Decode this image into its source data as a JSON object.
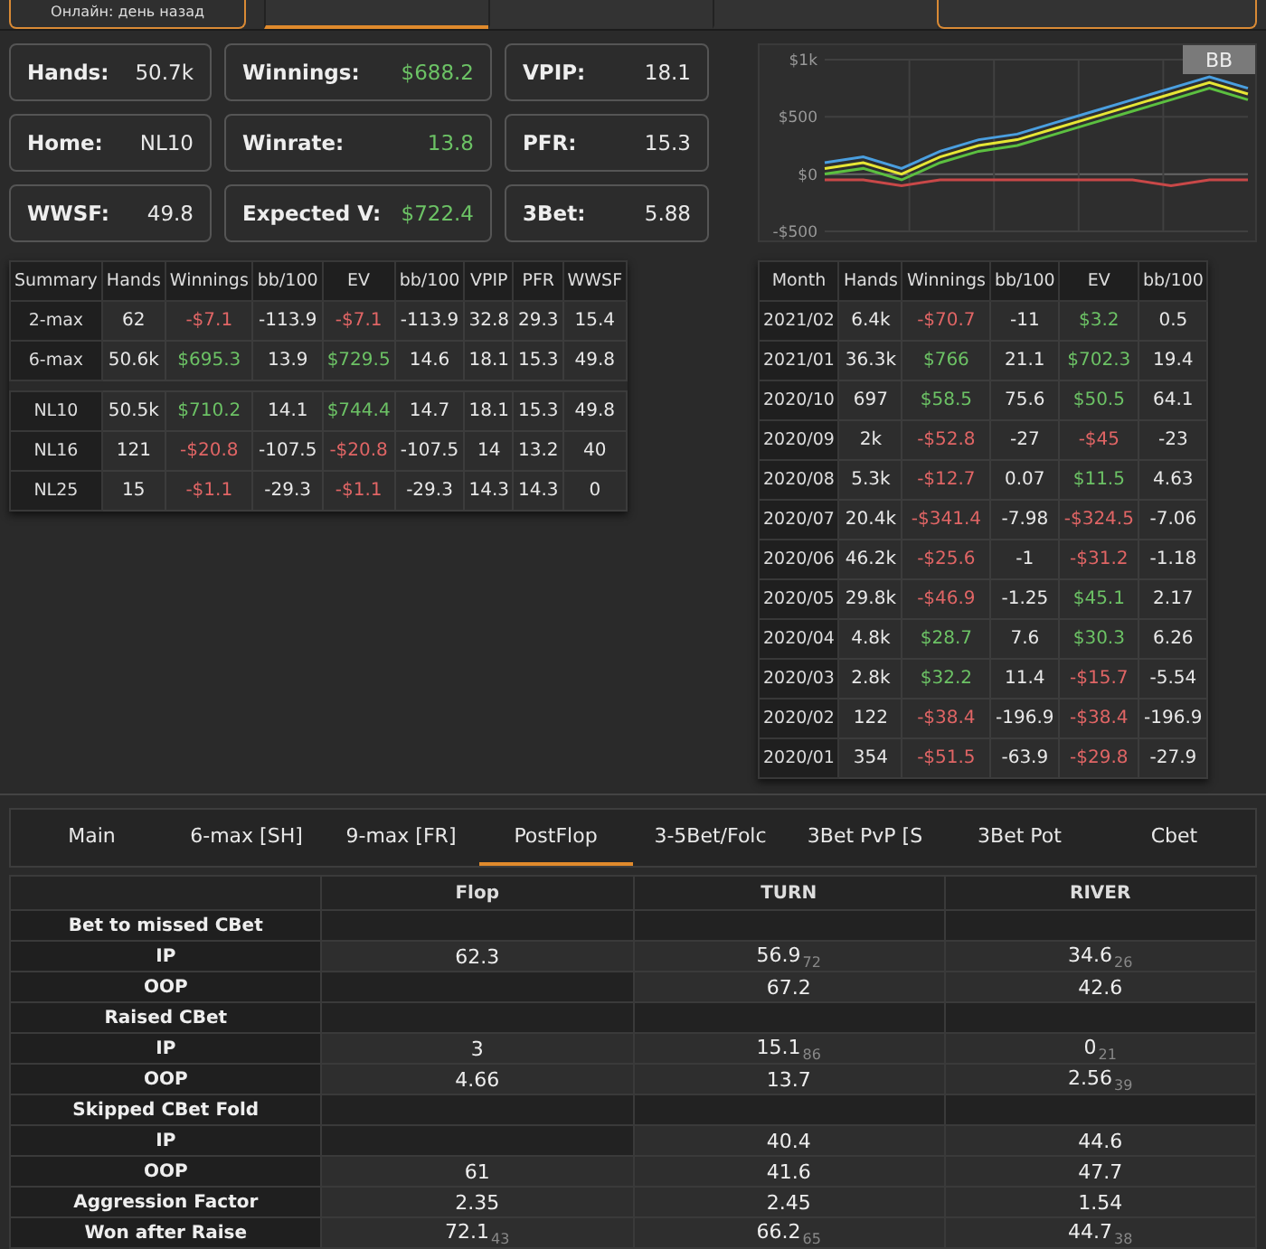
{
  "header": {
    "status": "Онлайн: день назад",
    "nav_tabs": [
      {
        "selected": true
      },
      {
        "selected": false
      },
      {
        "selected": false
      }
    ]
  },
  "stats": [
    {
      "label": "Hands:",
      "value": "50.7k",
      "color": "#e8e8e8"
    },
    {
      "label": "Winnings:",
      "value": "$688.2",
      "color": "#6cc265"
    },
    {
      "label": "VPIP:",
      "value": "18.1",
      "color": "#e8e8e8"
    },
    {
      "label": "Home:",
      "value": "NL10",
      "color": "#e8e8e8"
    },
    {
      "label": "Winrate:",
      "value": "13.8",
      "color": "#6cc265"
    },
    {
      "label": "PFR:",
      "value": "15.3",
      "color": "#e8e8e8"
    },
    {
      "label": "WWSF:",
      "value": "49.8",
      "color": "#e8e8e8"
    },
    {
      "label": "Expected V:",
      "value": "$722.4",
      "color": "#6cc265"
    },
    {
      "label": "3Bet:",
      "value": "5.88",
      "color": "#e8e8e8"
    }
  ],
  "graph": {
    "unit_button": "BB",
    "chart_data": {
      "type": "line",
      "ylim": [
        -500,
        1000
      ],
      "yticks": [
        {
          "value": 1000,
          "label": "$1k"
        },
        {
          "value": 500,
          "label": "$500"
        },
        {
          "value": 0,
          "label": "$0"
        },
        {
          "value": -500,
          "label": "-$500"
        }
      ],
      "series": [
        {
          "color": "#4a9fe0",
          "values": [
            100,
            150,
            50,
            200,
            300,
            350,
            450,
            550,
            650,
            750,
            850,
            750
          ]
        },
        {
          "color": "#5cc040",
          "values": [
            0,
            50,
            -50,
            100,
            200,
            250,
            350,
            450,
            550,
            650,
            750,
            650
          ]
        },
        {
          "color": "#e6e635",
          "values": [
            50,
            100,
            0,
            150,
            250,
            300,
            400,
            500,
            600,
            700,
            800,
            700
          ]
        },
        {
          "color": "#c84848",
          "values": [
            -50,
            -50,
            -100,
            -50,
            -50,
            -50,
            -50,
            -50,
            -50,
            -100,
            -50,
            -50
          ]
        }
      ]
    }
  },
  "summary": {
    "columns": [
      "Summary",
      "Hands",
      "Winnings",
      "bb/100",
      "EV",
      "bb/100",
      "VPIP",
      "PFR",
      "WWSF"
    ],
    "groups": [
      [
        {
          "label": "2-max",
          "cells": [
            "62",
            {
              "value": "-$7.1",
              "color": "#e06565"
            },
            "-113.9",
            {
              "value": "-$7.1",
              "color": "#e06565"
            },
            "-113.9",
            "32.8",
            "29.3",
            "15.4"
          ]
        },
        {
          "label": "6-max",
          "cells": [
            "50.6k",
            {
              "value": "$695.3",
              "color": "#6cc265"
            },
            "13.9",
            {
              "value": "$729.5",
              "color": "#6cc265"
            },
            "14.6",
            "18.1",
            "15.3",
            "49.8"
          ]
        }
      ],
      [
        {
          "label": "NL10",
          "cells": [
            "50.5k",
            {
              "value": "$710.2",
              "color": "#6cc265"
            },
            "14.1",
            {
              "value": "$744.4",
              "color": "#6cc265"
            },
            "14.7",
            "18.1",
            "15.3",
            "49.8"
          ]
        },
        {
          "label": "NL16",
          "cells": [
            "121",
            {
              "value": "-$20.8",
              "color": "#e06565"
            },
            "-107.5",
            {
              "value": "-$20.8",
              "color": "#e06565"
            },
            "-107.5",
            "14",
            "13.2",
            "40"
          ]
        },
        {
          "label": "NL25",
          "cells": [
            "15",
            {
              "value": "-$1.1",
              "color": "#e06565"
            },
            "-29.3",
            {
              "value": "-$1.1",
              "color": "#e06565"
            },
            "-29.3",
            "14.3",
            "14.3",
            "0"
          ]
        }
      ]
    ]
  },
  "months": {
    "columns": [
      "Month",
      "Hands",
      "Winnings",
      "bb/100",
      "EV",
      "bb/100"
    ],
    "rows": [
      {
        "cells": [
          "2021/02",
          "6.4k",
          {
            "value": "-$70.7",
            "color": "#e06565"
          },
          "-11",
          {
            "value": "$3.2",
            "color": "#6cc265"
          },
          "0.5"
        ]
      },
      {
        "cells": [
          "2021/01",
          "36.3k",
          {
            "value": "$766",
            "color": "#6cc265"
          },
          "21.1",
          {
            "value": "$702.3",
            "color": "#6cc265"
          },
          "19.4"
        ]
      },
      {
        "cells": [
          "2020/10",
          "697",
          {
            "value": "$58.5",
            "color": "#6cc265"
          },
          "75.6",
          {
            "value": "$50.5",
            "color": "#6cc265"
          },
          "64.1"
        ]
      },
      {
        "cells": [
          "2020/09",
          "2k",
          {
            "value": "-$52.8",
            "color": "#e06565"
          },
          "-27",
          {
            "value": "-$45",
            "color": "#e06565"
          },
          "-23"
        ]
      },
      {
        "cells": [
          "2020/08",
          "5.3k",
          {
            "value": "-$12.7",
            "color": "#e06565"
          },
          "0.07",
          {
            "value": "$11.5",
            "color": "#6cc265"
          },
          "4.63"
        ]
      },
      {
        "cells": [
          "2020/07",
          "20.4k",
          {
            "value": "-$341.4",
            "color": "#e06565"
          },
          "-7.98",
          {
            "value": "-$324.5",
            "color": "#e06565"
          },
          "-7.06"
        ]
      },
      {
        "cells": [
          "2020/06",
          "46.2k",
          {
            "value": "-$25.6",
            "color": "#e06565"
          },
          "-1",
          {
            "value": "-$31.2",
            "color": "#e06565"
          },
          "-1.18"
        ]
      },
      {
        "cells": [
          "2020/05",
          "29.8k",
          {
            "value": "-$46.9",
            "color": "#e06565"
          },
          "-1.25",
          {
            "value": "$45.1",
            "color": "#6cc265"
          },
          "2.17"
        ]
      },
      {
        "cells": [
          "2020/04",
          "4.8k",
          {
            "value": "$28.7",
            "color": "#6cc265"
          },
          "7.6",
          {
            "value": "$30.3",
            "color": "#6cc265"
          },
          "6.26"
        ]
      },
      {
        "cells": [
          "2020/03",
          "2.8k",
          {
            "value": "$32.2",
            "color": "#6cc265"
          },
          "11.4",
          {
            "value": "-$15.7",
            "color": "#e06565"
          },
          "-5.54"
        ]
      },
      {
        "cells": [
          "2020/02",
          "122",
          {
            "value": "-$38.4",
            "color": "#e06565"
          },
          "-196.9",
          {
            "value": "-$38.4",
            "color": "#e06565"
          },
          "-196.9"
        ]
      },
      {
        "cells": [
          "2020/01",
          "354",
          {
            "value": "-$51.5",
            "color": "#e06565"
          },
          "-63.9",
          {
            "value": "-$29.8",
            "color": "#e06565"
          },
          "-27.9"
        ]
      }
    ]
  },
  "tabs": [
    {
      "label": "Main",
      "selected": false
    },
    {
      "label": "6-max [SH]",
      "selected": false
    },
    {
      "label": "9-max [FR]",
      "selected": false
    },
    {
      "label": "PostFlop",
      "selected": true
    },
    {
      "label": "3-5Bet/Folc",
      "selected": false
    },
    {
      "label": "3Bet PvP [S",
      "selected": false
    },
    {
      "label": "3Bet Pot",
      "selected": false
    },
    {
      "label": "Cbet",
      "selected": false
    }
  ],
  "postflop": {
    "columns": [
      "Flop",
      "TURN",
      "RIVER"
    ],
    "rows": [
      {
        "kind": "section",
        "label": "Bet to missed CBet"
      },
      {
        "kind": "stat",
        "label": "IP",
        "cells": [
          {
            "value": "62.3"
          },
          {
            "value": "56.9",
            "sub": "72"
          },
          {
            "value": "34.6",
            "sub": "26"
          }
        ]
      },
      {
        "kind": "stat",
        "label": "OOP",
        "cells": [
          null,
          {
            "value": "67.2"
          },
          {
            "value": "42.6"
          }
        ]
      },
      {
        "kind": "section",
        "label": "Raised CBet"
      },
      {
        "kind": "stat",
        "label": "IP",
        "cells": [
          {
            "value": "3"
          },
          {
            "value": "15.1",
            "sub": "86"
          },
          {
            "value": "0",
            "sub": "21"
          }
        ]
      },
      {
        "kind": "stat",
        "label": "OOP",
        "cells": [
          {
            "value": "4.66"
          },
          {
            "value": "13.7"
          },
          {
            "value": "2.56",
            "sub": "39"
          }
        ]
      },
      {
        "kind": "section",
        "label": "Skipped CBet Fold"
      },
      {
        "kind": "stat",
        "label": "IP",
        "cells": [
          null,
          {
            "value": "40.4"
          },
          {
            "value": "44.6"
          }
        ]
      },
      {
        "kind": "stat",
        "label": "OOP",
        "cells": [
          {
            "value": "61"
          },
          {
            "value": "41.6"
          },
          {
            "value": "47.7"
          }
        ]
      },
      {
        "kind": "stat",
        "label": "Aggression Factor",
        "cells": [
          {
            "value": "2.35"
          },
          {
            "value": "2.45"
          },
          {
            "value": "1.54"
          }
        ]
      },
      {
        "kind": "stat",
        "label": "Won after Raise",
        "cells": [
          {
            "value": "72.1",
            "sub": "43"
          },
          {
            "value": "66.2",
            "sub": "65"
          },
          {
            "value": "44.7",
            "sub": "38"
          }
        ]
      }
    ]
  }
}
